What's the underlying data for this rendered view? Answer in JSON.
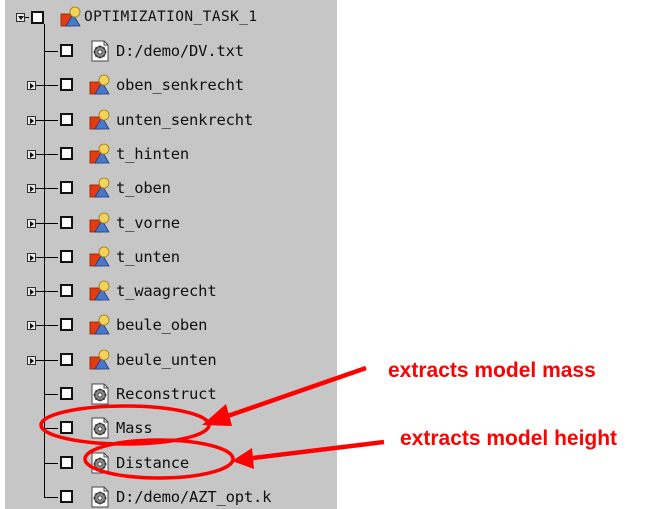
{
  "tree": {
    "root": {
      "label": "OPTIMIZATION_TASK_1",
      "icon": "task-icon"
    },
    "items": [
      {
        "label": "D:/demo/DV.txt",
        "icon": "gear-document-icon",
        "expandable": false
      },
      {
        "label": "oben_senkrecht",
        "icon": "task-icon",
        "expandable": true
      },
      {
        "label": "unten_senkrecht",
        "icon": "task-icon",
        "expandable": true
      },
      {
        "label": "t_hinten",
        "icon": "task-icon",
        "expandable": true
      },
      {
        "label": "t_oben",
        "icon": "task-icon",
        "expandable": true
      },
      {
        "label": "t_vorne",
        "icon": "task-icon",
        "expandable": true
      },
      {
        "label": "t_unten",
        "icon": "task-icon",
        "expandable": true
      },
      {
        "label": "t_waagrecht",
        "icon": "task-icon",
        "expandable": true
      },
      {
        "label": "beule_oben",
        "icon": "task-icon",
        "expandable": true
      },
      {
        "label": "beule_unten",
        "icon": "task-icon",
        "expandable": true
      },
      {
        "label": "Reconstruct",
        "icon": "gear-document-icon",
        "expandable": false
      },
      {
        "label": "Mass",
        "icon": "gear-document-icon",
        "expandable": false
      },
      {
        "label": "Distance",
        "icon": "gear-document-icon",
        "expandable": false
      },
      {
        "label": "D:/demo/AZT_opt.k",
        "icon": "gear-document-icon",
        "expandable": false
      }
    ]
  },
  "annotations": {
    "mass": "extracts model mass",
    "height": "extracts model height"
  },
  "colors": {
    "panel": "#c6c6c6",
    "annotation": "#ff0000"
  }
}
